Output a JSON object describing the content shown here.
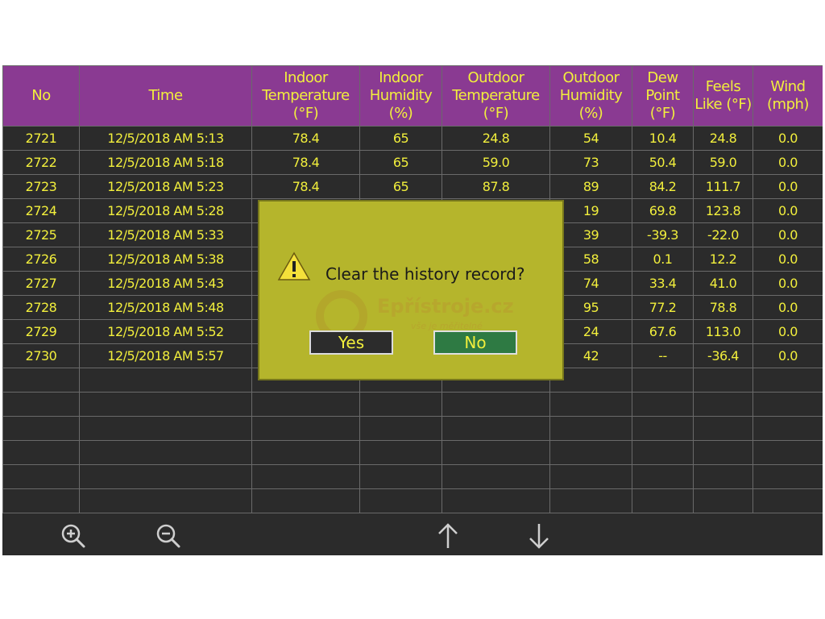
{
  "headers": [
    "No",
    "Time",
    "Indoor Temperature (°F)",
    "Indoor Humidity (%)",
    "Outdoor Temperature (°F)",
    "Outdoor Humidity (%)",
    "Dew Point (°F)",
    "Feels Like (°F)",
    "Wind (mph)"
  ],
  "rows": [
    [
      "2721",
      "12/5/2018 AM 5:13",
      "78.4",
      "65",
      "24.8",
      "54",
      "10.4",
      "24.8",
      "0.0"
    ],
    [
      "2722",
      "12/5/2018 AM 5:18",
      "78.4",
      "65",
      "59.0",
      "73",
      "50.4",
      "59.0",
      "0.0"
    ],
    [
      "2723",
      "12/5/2018 AM 5:23",
      "78.4",
      "65",
      "87.8",
      "89",
      "84.2",
      "111.7",
      "0.0"
    ],
    [
      "2724",
      "12/5/2018 AM 5:28",
      "",
      "",
      "",
      "19",
      "69.8",
      "123.8",
      "0.0"
    ],
    [
      "2725",
      "12/5/2018 AM 5:33",
      "",
      "",
      "",
      "39",
      "-39.3",
      "-22.0",
      "0.0"
    ],
    [
      "2726",
      "12/5/2018 AM 5:38",
      "",
      "",
      "",
      "58",
      "0.1",
      "12.2",
      "0.0"
    ],
    [
      "2727",
      "12/5/2018 AM 5:43",
      "",
      "",
      "",
      "74",
      "33.4",
      "41.0",
      "0.0"
    ],
    [
      "2728",
      "12/5/2018 AM 5:48",
      "",
      "",
      "",
      "95",
      "77.2",
      "78.8",
      "0.0"
    ],
    [
      "2729",
      "12/5/2018 AM 5:52",
      "",
      "",
      "",
      "24",
      "67.6",
      "113.0",
      "0.0"
    ],
    [
      "2730",
      "12/5/2018 AM 5:57",
      "",
      "",
      "",
      "42",
      "--",
      "-36.4",
      "0.0"
    ]
  ],
  "empty_rows": 6,
  "toolbar": {
    "icons": [
      "zoom-in-icon",
      "zoom-out-icon",
      "arrow-up-icon",
      "arrow-down-icon"
    ]
  },
  "dialog": {
    "message": "Clear the history record?",
    "yes_label": "Yes",
    "no_label": "No",
    "icon": "warning-icon",
    "watermark": {
      "brand": "Epřístroje.cz",
      "tagline": "vše je měřitelné"
    }
  },
  "colors": {
    "header_bg": "#8a3a92",
    "text": "#f2ef3c",
    "screen_bg": "#2b2b2b",
    "dialog_bg": "#b5b52c",
    "no_button_bg": "#2e7a43"
  }
}
